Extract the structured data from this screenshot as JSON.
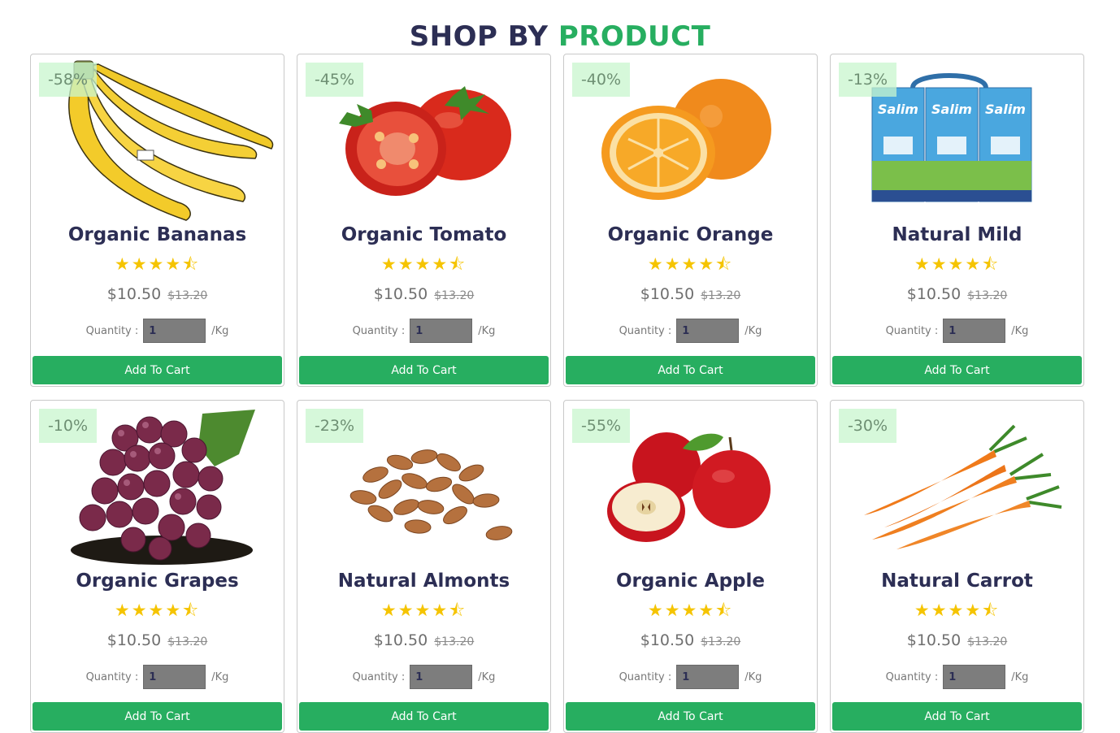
{
  "heading": {
    "part1": "SHOP BY",
    "part2": "PRODUCT"
  },
  "colors": {
    "accent": "#27ae60",
    "title": "#2c2e54",
    "star": "#f5c400",
    "badge_bg": "#ddf7e0"
  },
  "quantity_label": "Quantity :",
  "unit": "/Kg",
  "button_label": "Add To Cart",
  "products": [
    {
      "name": "Organic Bananas",
      "discount": "-58%",
      "price": "$10.50",
      "old_price": "$13.20",
      "rating": "★★★★⯪",
      "rating_value": 4.5,
      "quantity": "1",
      "image": "banana-image"
    },
    {
      "name": "Organic Tomato",
      "discount": "-45%",
      "price": "$10.50",
      "old_price": "$13.20",
      "rating": "★★★★⯪",
      "rating_value": 4.5,
      "quantity": "1",
      "image": "tomato-image"
    },
    {
      "name": "Organic Orange",
      "discount": "-40%",
      "price": "$10.50",
      "old_price": "$13.20",
      "rating": "★★★★⯪",
      "rating_value": 4.5,
      "quantity": "1",
      "image": "orange-image"
    },
    {
      "name": "Natural Mild",
      "discount": "-13%",
      "price": "$10.50",
      "old_price": "$13.20",
      "rating": "★★★★⯪",
      "rating_value": 4.5,
      "quantity": "1",
      "image": "milk-image",
      "image_text": "Salim"
    },
    {
      "name": "Organic Grapes",
      "discount": "-10%",
      "price": "$10.50",
      "old_price": "$13.20",
      "rating": "★★★★⯪",
      "rating_value": 4.5,
      "quantity": "1",
      "image": "grapes-image"
    },
    {
      "name": "Natural Almonts",
      "discount": "-23%",
      "price": "$10.50",
      "old_price": "$13.20",
      "rating": "★★★★⯪",
      "rating_value": 4.5,
      "quantity": "1",
      "image": "almonds-image"
    },
    {
      "name": "Organic Apple",
      "discount": "-55%",
      "price": "$10.50",
      "old_price": "$13.20",
      "rating": "★★★★⯪",
      "rating_value": 4.5,
      "quantity": "1",
      "image": "apple-image"
    },
    {
      "name": "Natural Carrot",
      "discount": "-30%",
      "price": "$10.50",
      "old_price": "$13.20",
      "rating": "★★★★⯪",
      "rating_value": 4.5,
      "quantity": "1",
      "image": "carrot-image"
    }
  ]
}
